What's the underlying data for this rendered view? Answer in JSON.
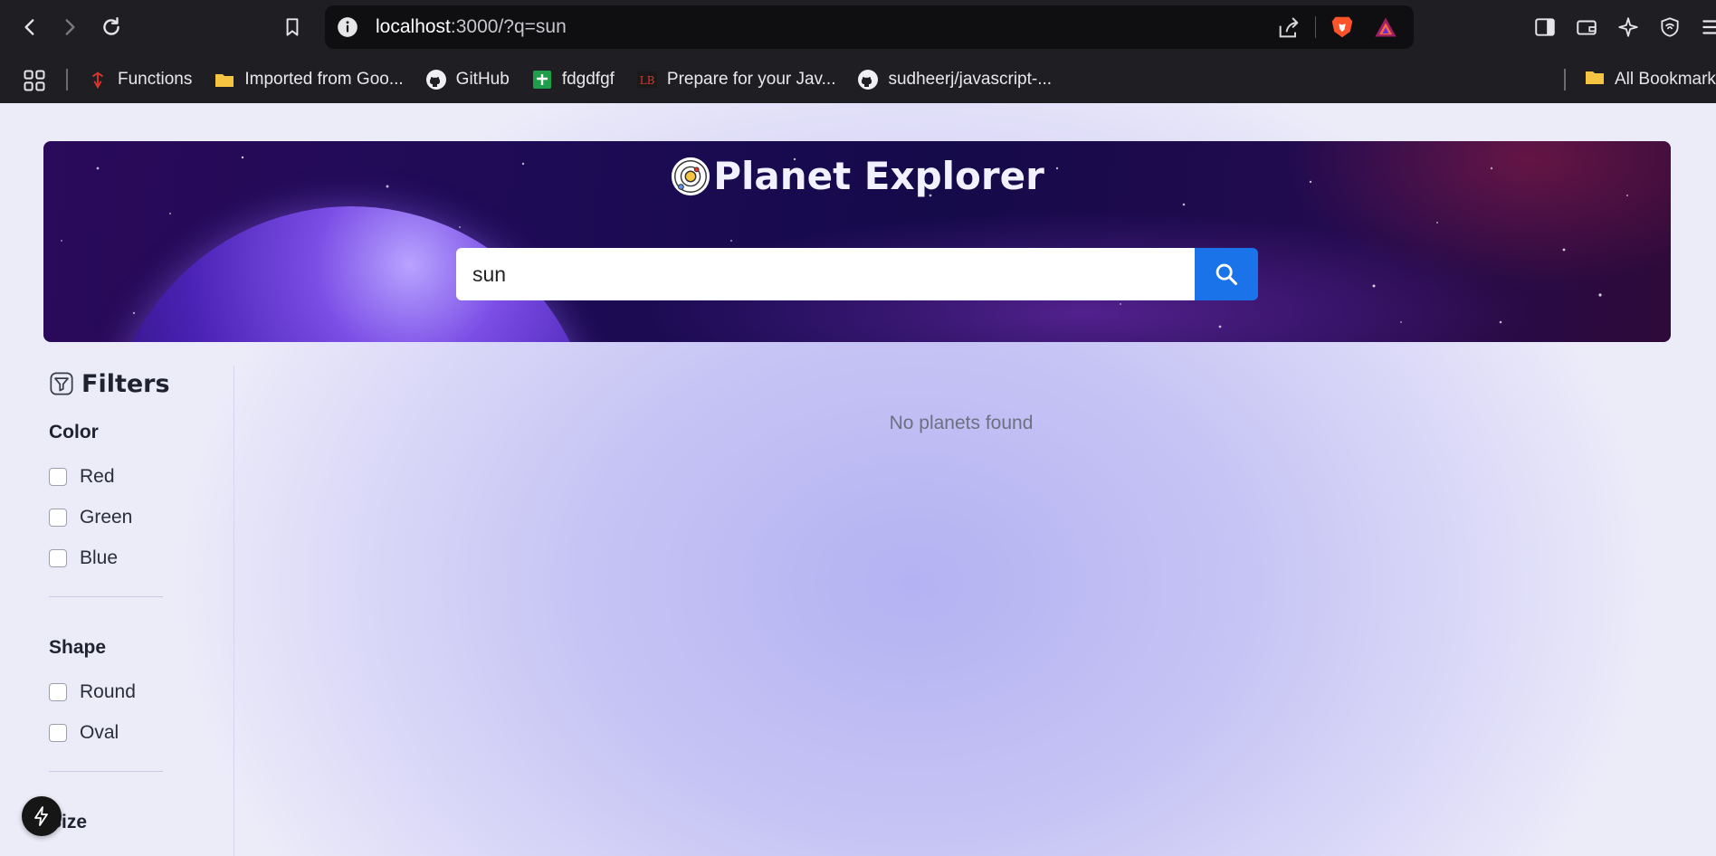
{
  "browser": {
    "url_host": "localhost",
    "url_path": ":3000/?q=sun",
    "bookmarks": [
      {
        "label": "Functions",
        "icon": "function-icon"
      },
      {
        "label": "Imported from Goo...",
        "icon": "folder-icon"
      },
      {
        "label": "GitHub",
        "icon": "github-icon"
      },
      {
        "label": "fdgdfgf",
        "icon": "sheets-icon"
      },
      {
        "label": "Prepare for your Jav...",
        "icon": "lb-icon"
      },
      {
        "label": "sudheerj/javascript-...",
        "icon": "github-icon"
      }
    ],
    "all_bookmarks": "All Bookmarks"
  },
  "hero": {
    "title": "Planet Explorer",
    "search_value": "sun"
  },
  "filters": {
    "title": "Filters",
    "color": {
      "title": "Color",
      "options": [
        "Red",
        "Green",
        "Blue"
      ]
    },
    "shape": {
      "title": "Shape",
      "options": [
        "Round",
        "Oval"
      ]
    },
    "size": {
      "title": "Size"
    }
  },
  "results": {
    "empty_message": "No planets found"
  },
  "colors": {
    "accent": "#1a73e8",
    "toolbar": "#1f1f23"
  }
}
